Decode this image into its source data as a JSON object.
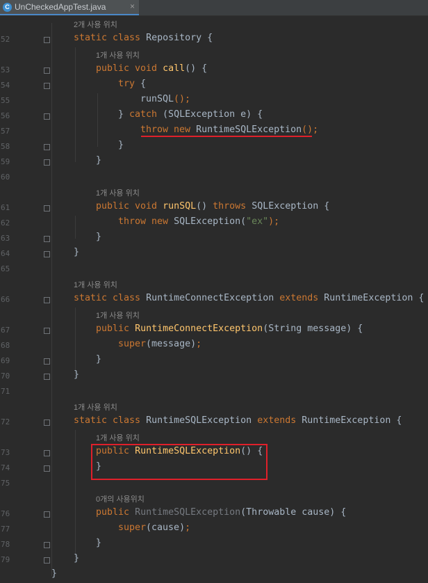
{
  "tab": {
    "icon": "java-class-icon",
    "icon_letter": "C",
    "title": "UnCheckedAppTest.java",
    "close": "×"
  },
  "hints": {
    "h52": "2개 사용 위치",
    "h53": "1개 사용 위치",
    "h61": "1개 사용 위치",
    "h66": "1개 사용 위치",
    "h67": "1개 사용 위치",
    "h72": "1개 사용 위치",
    "h73": "1개 사용 위치",
    "h76": "0개의 사용위치"
  },
  "line_numbers": {
    "l52": "52",
    "l53": "53",
    "l54": "54",
    "l55": "55",
    "l56": "56",
    "l57": "57",
    "l58": "58",
    "l59": "59",
    "l60": "60",
    "l61": "61",
    "l62": "62",
    "l63": "63",
    "l64": "64",
    "l65": "65",
    "l66": "66",
    "l67": "67",
    "l68": "68",
    "l69": "69",
    "l70": "70",
    "l71": "71",
    "l72": "72",
    "l73": "73",
    "l74": "74",
    "l75": "75",
    "l76": "76",
    "l77": "77",
    "l78": "78",
    "l79": "79"
  },
  "code": {
    "c52": {
      "kw": "static class",
      "rest": " Repository {"
    },
    "c53": {
      "kw": "public void",
      "fn": "call",
      "rest": "() {"
    },
    "c54": {
      "kw": "try",
      "rest": " {"
    },
    "c55": {
      "rest": "runSQL",
      "semi": "();"
    },
    "c56": {
      "pre": "} ",
      "kw": "catch",
      "rest": " (SQLException e) {"
    },
    "c57": {
      "kw": "throw new",
      "rest": " RuntimeSQLException",
      "semi": "();"
    },
    "c58": {
      "rest": "}"
    },
    "c59": {
      "rest": "}"
    },
    "c61": {
      "kw": "public void",
      "fn": "runSQL",
      "mid": "() ",
      "kw2": "throws",
      "rest": " SQLException {"
    },
    "c62": {
      "kw": "throw new",
      "rest": " SQLException(",
      "str": "\"ex\"",
      "semi": ");"
    },
    "c63": {
      "rest": "}"
    },
    "c64": {
      "rest": "}"
    },
    "c66": {
      "kw": "static class",
      "rest": " RuntimeConnectException ",
      "kw2": "extends",
      "rest2": " RuntimeException {"
    },
    "c67": {
      "kw": "public",
      "fn": "RuntimeConnectException",
      "rest": "(String message) {"
    },
    "c68": {
      "kw": "super",
      "rest": "(message)",
      "semi": ";"
    },
    "c69": {
      "rest": "}"
    },
    "c70": {
      "rest": "}"
    },
    "c72": {
      "kw": "static class",
      "rest": " RuntimeSQLException ",
      "kw2": "extends",
      "rest2": " RuntimeException {"
    },
    "c73": {
      "kw": "public",
      "fn": "RuntimeSQLException",
      "rest": "() {"
    },
    "c74": {
      "rest": "}"
    },
    "c76": {
      "kw": "public",
      "dim": "RuntimeSQLException",
      "rest": "(Throwable cause) {"
    },
    "c77": {
      "kw": "super",
      "rest": "(cause)",
      "semi": ";"
    },
    "c78": {
      "rest": "}"
    },
    "c79": {
      "rest": "}"
    },
    "c80": {
      "rest": "}"
    }
  },
  "colors": {
    "background": "#2b2b2b",
    "keyword": "#cc7832",
    "method": "#ffc66d",
    "string": "#6a8759",
    "highlight": "#e0202a"
  }
}
